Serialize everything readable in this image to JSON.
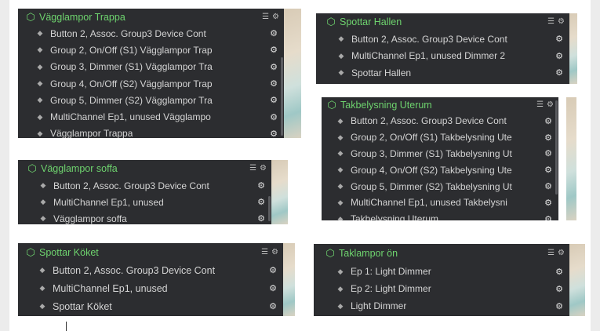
{
  "icons": {
    "node": "cube-icon",
    "row": "layers-icon",
    "list": "list-icon",
    "settings": "gear-icon"
  },
  "colors": {
    "panel_bg": "#2c2d30",
    "title_green": "#6ed36e",
    "row_text": "#d4d4d4"
  },
  "panels": [
    {
      "title": "Vägglampor Trappa",
      "rows": [
        "Button 2, Assoc. Group3 Device Cont",
        "Group 2, On/Off (S1) Vägglampor Trap",
        "Group 3, Dimmer (S1) Vägglampor Tra",
        "Group 4, On/Off (S2) Vägglampor Trap",
        "Group 5, Dimmer (S2) Vägglampor Tra",
        "MultiChannel Ep1, unused Vägglampo",
        "Vägglampor Trappa"
      ]
    },
    {
      "title": "Spottar Hallen",
      "rows": [
        "Button 2, Assoc. Group3 Device Cont",
        "MultiChannel Ep1, unused Dimmer 2",
        "Spottar Hallen"
      ]
    },
    {
      "title": "Takbelysning Uterum",
      "rows": [
        "Button 2, Assoc. Group3 Device Cont",
        "Group 2, On/Off (S1) Takbelysning Ute",
        "Group 3, Dimmer (S1) Takbelysning Ut",
        "Group 4, On/Off (S2) Takbelysning Ute",
        "Group 5, Dimmer (S2) Takbelysning Ut",
        "MultiChannel Ep1, unused Takbelysni",
        "Takbelysning Uterum"
      ]
    },
    {
      "title": "Vägglampor soffa",
      "rows": [
        "Button 2, Assoc. Group3 Device Cont",
        "MultiChannel Ep1, unused",
        "Vägglampor soffa"
      ]
    },
    {
      "title": "Spottar Köket",
      "rows": [
        "Button 2, Assoc. Group3 Device Cont",
        "MultiChannel Ep1, unused",
        "Spottar Köket"
      ]
    },
    {
      "title": "Taklampor ön",
      "rows": [
        "Ep 1: Light Dimmer",
        "Ep 2: Light Dimmer",
        "Light Dimmer"
      ]
    }
  ]
}
